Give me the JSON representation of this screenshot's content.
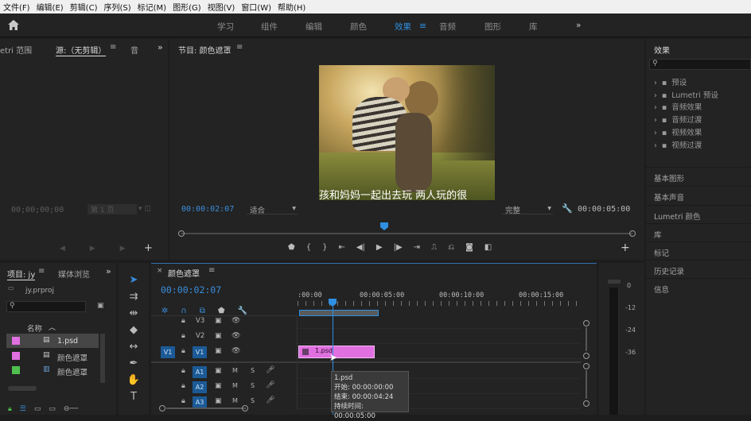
{
  "menu": [
    "文件(F)",
    "编辑(E)",
    "剪辑(C)",
    "序列(S)",
    "标记(M)",
    "图形(G)",
    "视图(V)",
    "窗口(W)",
    "帮助(H)"
  ],
  "workspaces": [
    "学习",
    "组件",
    "编辑",
    "颜色",
    "效果",
    "音频",
    "图形",
    "库"
  ],
  "workspace_active": "效果",
  "more": "»",
  "source": {
    "tab_lumetri": "etri 范围",
    "tab_source": "源:（无剪辑）",
    "tab_audio": "音",
    "timecode": "00;00;00;00",
    "page": "第 1 页"
  },
  "program": {
    "title": "节目: 颜色遮罩",
    "timecode": "00:00:02:07",
    "fit": "适合",
    "quality": "完整",
    "duration": "00:00:05:00",
    "subtitle": "孩和妈妈一起出去玩 两人玩的很"
  },
  "project": {
    "tab_project": "项目: jy",
    "tab_media": "媒体浏览",
    "file": "jy.prproj",
    "col_name": "名称",
    "items": [
      {
        "name": "1.psd",
        "color": "#e070e0"
      },
      {
        "name": "颜色遮罩",
        "color": "#e070e0"
      },
      {
        "name": "颜色遮罩",
        "color": "#4fc04f"
      }
    ]
  },
  "timeline": {
    "tab": "颜色遮罩",
    "timecode": "00:00:02:07",
    "ruler": [
      ":00:00",
      "00:00:05:00",
      "00:00:10:00",
      "00:00:15:00"
    ],
    "video_tracks": [
      "V3",
      "V2",
      "V1"
    ],
    "audio_tracks": [
      "A1",
      "A2",
      "A3"
    ],
    "source_patch": "V1",
    "mute": "M",
    "solo": "S",
    "clip": "1.psd",
    "tooltip": {
      "name": "1.psd",
      "start": "开始: 00:00:00:00",
      "end": "结束: 00:00:04:24",
      "duration": "持续时间: 00:00:05:00"
    }
  },
  "meter": [
    "0",
    "-12",
    "-24",
    "-36"
  ],
  "effects": {
    "title": "效果",
    "items": [
      "预设",
      "Lumetri 预设",
      "音频效果",
      "音频过渡",
      "视频效果",
      "视频过渡"
    ],
    "sections": [
      "基本图形",
      "基本声音",
      "Lumetri 颜色",
      "库",
      "标记",
      "历史记录",
      "信息"
    ]
  },
  "colors": {
    "accent": "#2f8fe0",
    "clip_pink": "#e070e0",
    "track_blue": "#1b5a96"
  }
}
